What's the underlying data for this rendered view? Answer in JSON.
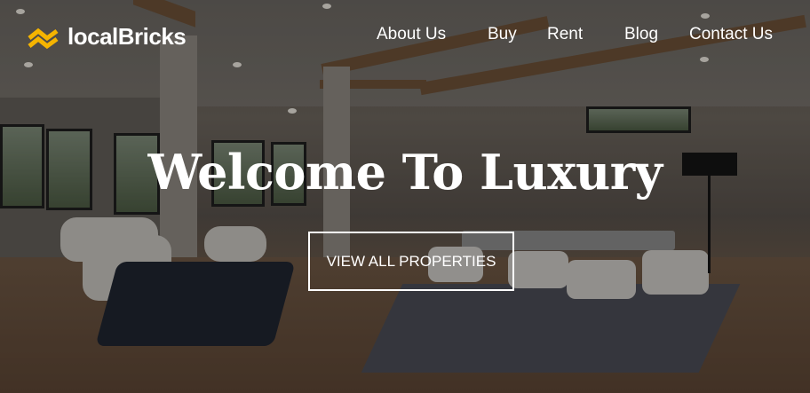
{
  "brand": {
    "name": "localBricks",
    "logo_icon": "stacked-bricks-icon",
    "accent": "#f5b400"
  },
  "nav": {
    "links": [
      {
        "label": "About Us"
      },
      {
        "label": "Buy"
      },
      {
        "label": "Rent"
      },
      {
        "label": "Blog"
      },
      {
        "label": "Contact Us"
      }
    ]
  },
  "hero": {
    "headline": "Welcome To Luxury",
    "cta_label": "VIEW ALL PROPERTIES"
  }
}
